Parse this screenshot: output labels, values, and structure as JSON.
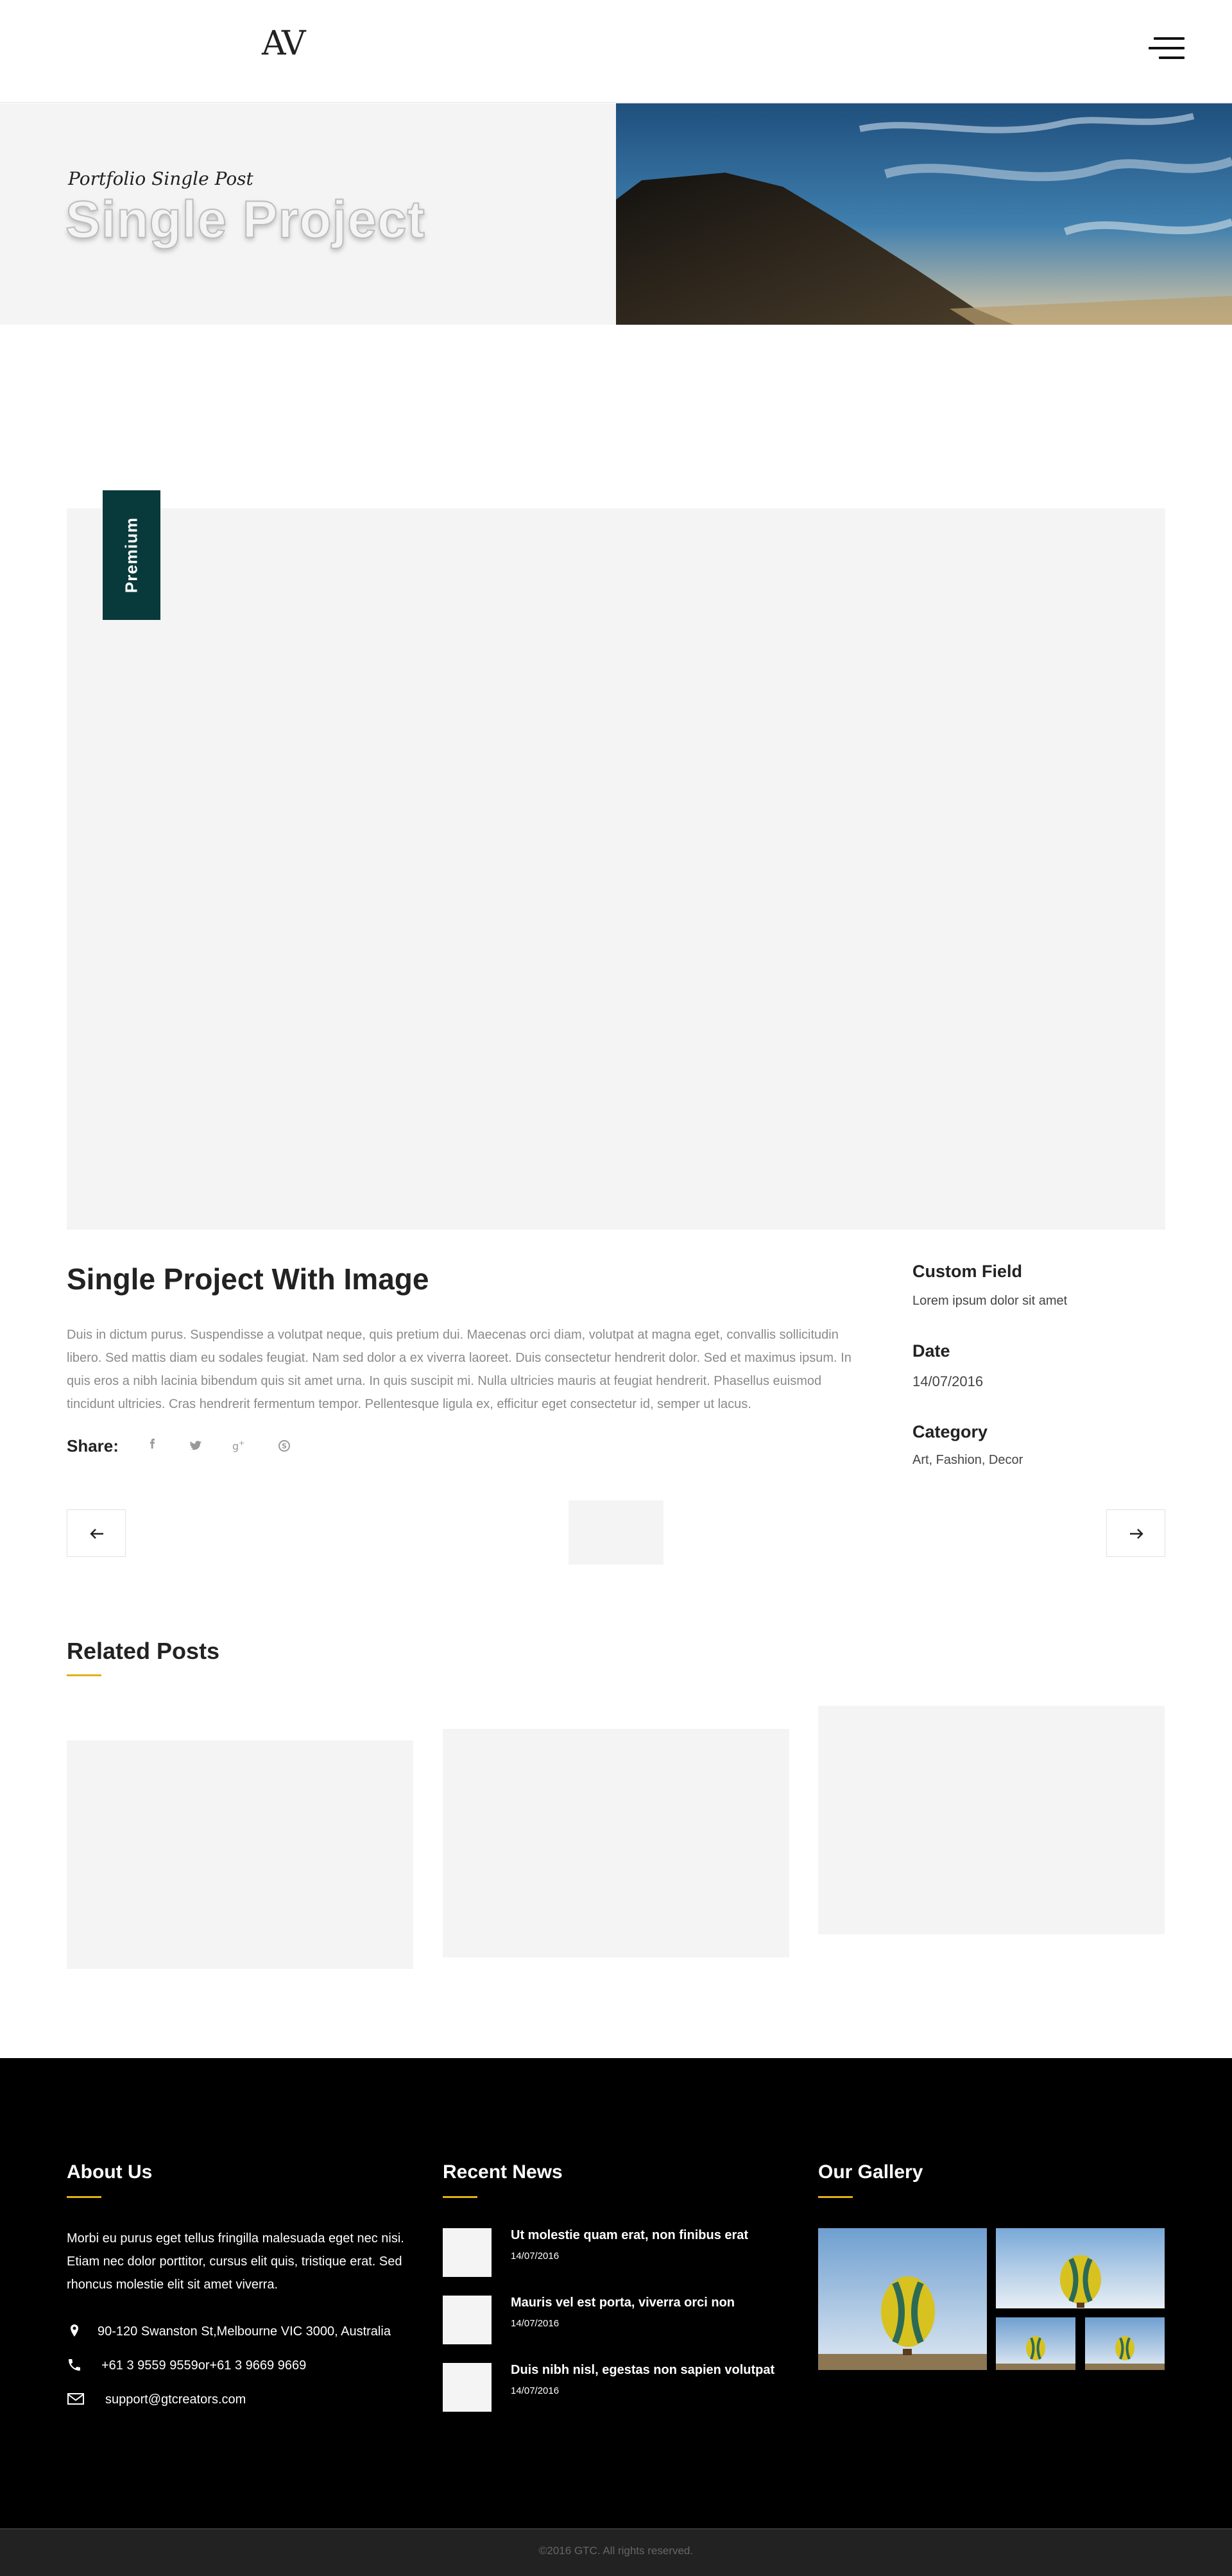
{
  "header": {
    "logo": "AV",
    "menu_icon": "hamburger-menu-icon"
  },
  "hero": {
    "subtitle": "Portfolio Single Post",
    "title": "Single Project"
  },
  "project": {
    "badge": "Premium",
    "title": "Single Project With Image",
    "description": "Duis in dictum purus. Suspendisse a volutpat neque, quis pretium dui. Maecenas orci diam, volutpat at magna eget, convallis sollicitudin libero. Sed mattis diam eu sodales feugiat. Nam sed dolor a ex viverra laoreet. Duis consectetur hendrerit dolor. Sed et maximus ipsum. In quis eros a nibh lacinia bibendum quis sit amet urna. In quis suscipit mi. Nulla ultricies mauris at feugiat hendrerit. Phasellus euismod tincidunt ultricies. Cras hendrerit fermentum tempor. Pellentesque ligula ex, efficitur eget consectetur id, semper ut lacus.",
    "share_label": "Share:",
    "share_icons": [
      "facebook-icon",
      "twitter-icon",
      "google-plus-icon",
      "skype-icon"
    ]
  },
  "meta": {
    "custom_field_label": "Custom Field",
    "custom_field_value": "Lorem ipsum dolor sit amet",
    "date_label": "Date",
    "date_value": "14/07/2016",
    "category_label": "Category",
    "category_value": "Art, Fashion, Decor"
  },
  "pagination": {
    "prev_icon": "arrow-left-icon",
    "next_icon": "arrow-right-icon"
  },
  "related": {
    "title": "Related Posts"
  },
  "footer": {
    "about_title": "About Us",
    "about_text": "Morbi eu purus eget tellus fringilla malesuada eget nec nisi. Etiam nec dolor porttitor, cursus elit quis, tristique erat. Sed rhoncus molestie elit sit amet viverra.",
    "address": "90-120 Swanston St,Melbourne VIC 3000, Australia",
    "phone": "+61 3 9559 9559or+61 3 9669 9669",
    "email": "support@gtcreators.com",
    "news_title": "Recent News",
    "news": [
      {
        "title": "Ut molestie quam erat, non finibus erat",
        "date": "14/07/2016"
      },
      {
        "title": "Mauris vel est porta, viverra orci non",
        "date": "14/07/2016"
      },
      {
        "title": "Duis nibh nisl, egestas non sapien volutpat",
        "date": "14/07/2016"
      }
    ],
    "gallery_title": "Our Gallery",
    "copyright": "©2016 GTC. All rights reserved."
  },
  "colors": {
    "accent": "#e2b017",
    "badge": "#083a3b",
    "footer_bg": "#000000",
    "placeholder": "#f4f4f4"
  }
}
